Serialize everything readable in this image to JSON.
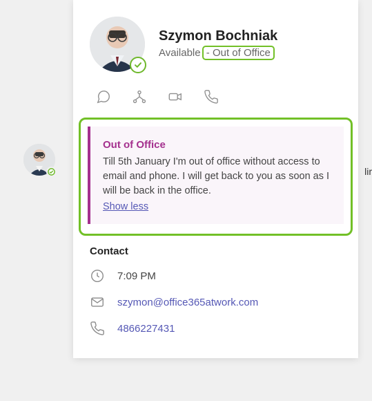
{
  "bg_fragment": "lir",
  "profile": {
    "name": "Szymon Bochniak",
    "status_prefix": "Available",
    "status_highlighted": "- Out of Office",
    "presence_color": "#6eb82b"
  },
  "actions": {
    "chat": "chat",
    "org": "org",
    "video": "video",
    "call": "call"
  },
  "ooo": {
    "title": "Out of Office",
    "body": "Till 5th January I'm out of office without access to email and phone. I will get back to you as soon as I will be back in the office.",
    "toggle": "Show less",
    "accent": "#a4308e"
  },
  "contact": {
    "heading": "Contact",
    "time": "7:09 PM",
    "email": "szymon@office365atwork.com",
    "phone": "4866227431"
  }
}
